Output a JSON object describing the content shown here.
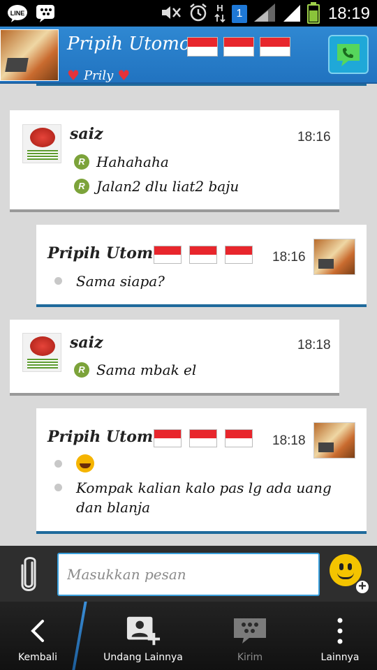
{
  "status_bar": {
    "time": "18:19",
    "sim_label": "1",
    "battery_percent": 65
  },
  "header": {
    "contact_name": "Pripih Utomo",
    "status_text": "Prily",
    "flag_count": 3,
    "icons": {
      "call": "call-icon",
      "heart": "heart-icon"
    }
  },
  "messages": [
    {
      "direction": "in",
      "sender": "saiz",
      "time": "18:16",
      "lines": [
        "Hahahaha",
        "Jalan2 dlu liat2 baju"
      ]
    },
    {
      "direction": "out",
      "sender": "Pripih Utomo",
      "time": "18:16",
      "lines": [
        "Sama siapa?"
      ]
    },
    {
      "direction": "in",
      "sender": "saiz",
      "time": "18:18",
      "lines": [
        "Sama mbak el"
      ]
    },
    {
      "direction": "out",
      "sender": "Pripih Utomo",
      "time": "18:18",
      "lines": [
        "[emoji: laughing]",
        "Kompak kalian kalo pas lg ada uang dan blanja"
      ]
    }
  ],
  "read_marker": "R",
  "composer": {
    "placeholder": "Masukkan pesan"
  },
  "nav": {
    "back": "Kembali",
    "invite": "Undang Lainnya",
    "send": "Kirim",
    "more": "Lainnya"
  },
  "colors": {
    "header_blue": "#2a7fca",
    "outgoing_border": "#1f6a9c",
    "incoming_border": "#9a9a9a",
    "read_badge": "#7ca33a"
  }
}
